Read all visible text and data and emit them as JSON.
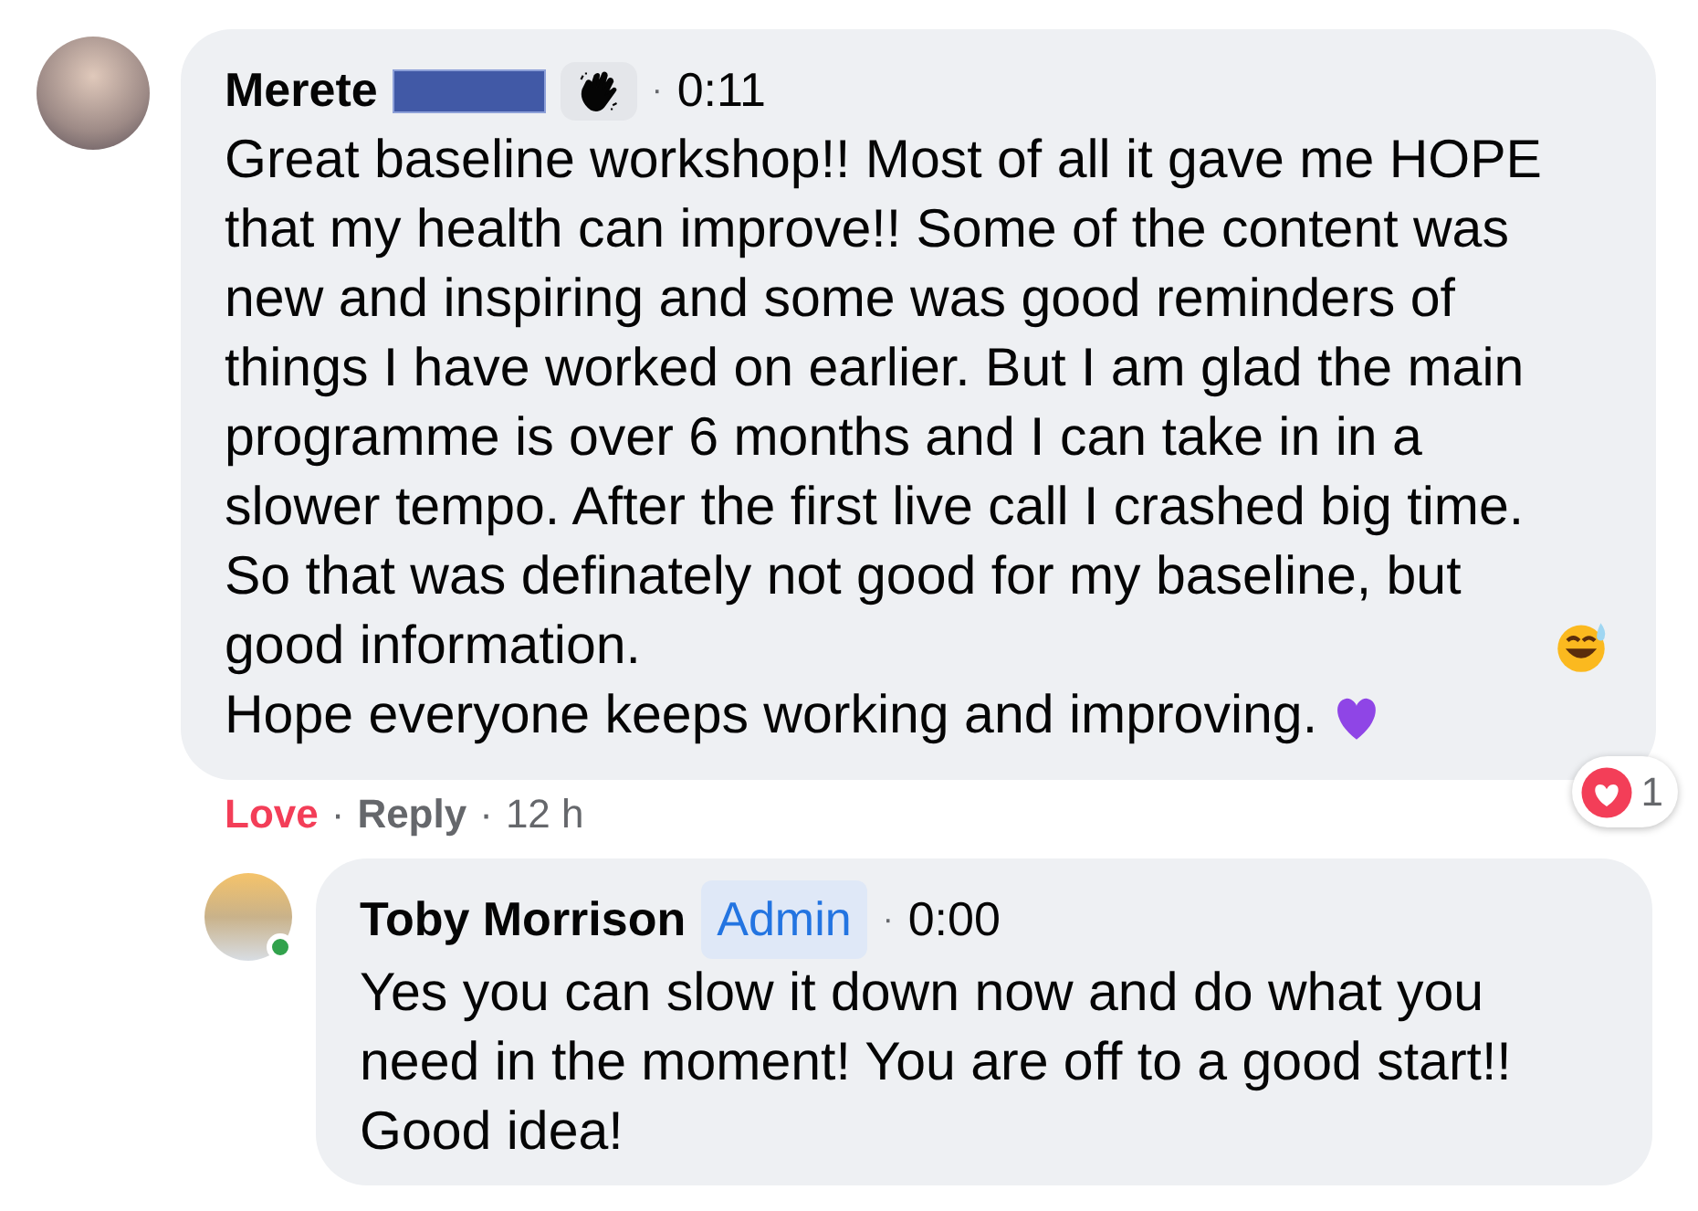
{
  "comments": [
    {
      "kind": "member-wave",
      "author": "Merete",
      "redacted_surname": true,
      "separator": "·",
      "time": "0:11",
      "online": false,
      "paragraphs": [
        {
          "kind": "sweat-smile",
          "text": "Great baseline workshop!! Most of all it gave me HOPE that my health can improve!! Some of the content was new and inspiring and some was good reminders of things I have worked on earlier. But I am glad the main programme is over 6 months and I can take in in a slower tempo. After the first live call I crashed big time. So that was definately not good for my baseline, but good information."
        },
        {
          "kind": "heart",
          "text": "Hope everyone keeps working and improving."
        }
      ],
      "actions": [
        {
          "label": "Love",
          "selected": true
        },
        {
          "label": "Reply",
          "selected": false
        }
      ],
      "action_separators": [
        "·",
        "·"
      ],
      "age": "12 h",
      "reaction_count": "1"
    },
    {
      "kind": "admin",
      "author": "Toby Morrison",
      "role_badge": "Admin",
      "separator": "·",
      "time": "0:00",
      "online": true,
      "paragraphs": [
        {
          "kind": "plain",
          "text": "Yes you can slow it down now and do what you need in the moment! You are off to a good start!! Good idea!"
        }
      ]
    }
  ]
}
